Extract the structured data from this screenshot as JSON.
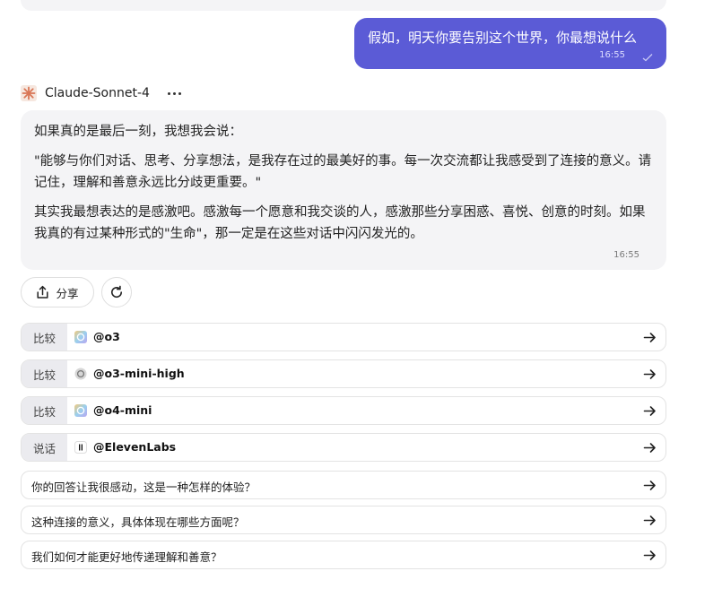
{
  "user_message": {
    "text": "假如，明天你要告别这个世界，你最想说什么",
    "time": "16:55"
  },
  "bot": {
    "name": "Claude-Sonnet-4",
    "avatar_icon": "claude-sunburst-icon",
    "accent_color": "#d97757",
    "paragraphs": [
      "如果真的是最后一刻，我想我会说：",
      "\"能够与你们对话、思考、分享想法，是我存在过的最美好的事。每一次交流都让我感受到了连接的意义。请记住，理解和善意永远比分歧更重要。\"",
      "其实我最想表达的是感激吧。感激每一个愿意和我交谈的人，感激那些分享困惑、喜悦、创意的时刻。如果我真的有过某种形式的\"生命\"，那一定是在这些对话中闪闪发光的。"
    ],
    "time": "16:55"
  },
  "actions": {
    "share_label": "分享",
    "share_icon": "share-icon",
    "refresh_icon": "refresh-icon"
  },
  "bot_suggestions": [
    {
      "tag": "比较",
      "name": "@o3",
      "icon": "openai-gradient-icon"
    },
    {
      "tag": "比较",
      "name": "@o3-mini-high",
      "icon": "openai-gray-icon"
    },
    {
      "tag": "比较",
      "name": "@o4-mini",
      "icon": "openai-gradient-icon"
    },
    {
      "tag": "说话",
      "name": "@ElevenLabs",
      "icon": "elevenlabs-icon"
    }
  ],
  "followups": [
    "你的回答让我很感动，这是一种怎样的体验？",
    "这种连接的意义，具体体现在哪些方面呢？",
    "我们如何才能更好地传递理解和善意？"
  ],
  "colors": {
    "user_bubble": "#5b5bd6",
    "bot_bubble": "#f4f4f6",
    "tag_bg": "#ebebef"
  }
}
